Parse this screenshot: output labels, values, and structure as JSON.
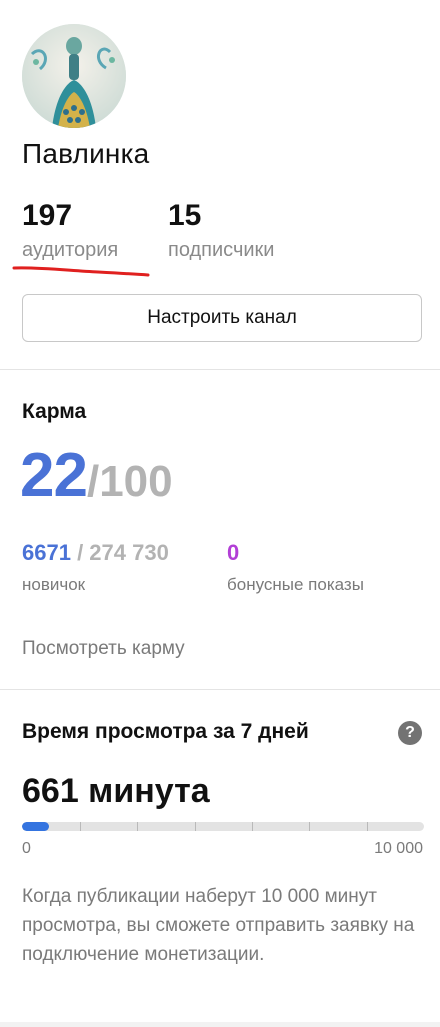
{
  "profile": {
    "name": "Павлинка",
    "stats": [
      {
        "value": "197",
        "label": "аудитория"
      },
      {
        "value": "15",
        "label": "подписчики"
      }
    ],
    "setup_button": "Настроить канал"
  },
  "karma": {
    "title": "Карма",
    "value": "22",
    "max": "/100",
    "progress_current": "6671",
    "progress_total": " / 274 730",
    "progress_label": "новичок",
    "bonus_value": "0",
    "bonus_label": "бонусные показы",
    "link": "Посмотреть карму"
  },
  "watch_time": {
    "title": "Время просмотра за 7 дней",
    "help_icon": "?",
    "minutes": "661 минута",
    "progress_fraction": 0.0661,
    "scale_min": "0",
    "scale_max": "10 000",
    "note": "Когда публикации наберут 10 000 минут просмотра, вы сможете отправить заявку на подключение монетизации."
  },
  "colors": {
    "accent_blue": "#4a72d6",
    "bar_blue": "#3474e0",
    "bonus_purple": "#b23fd6",
    "annotation_red": "#e0201f"
  }
}
